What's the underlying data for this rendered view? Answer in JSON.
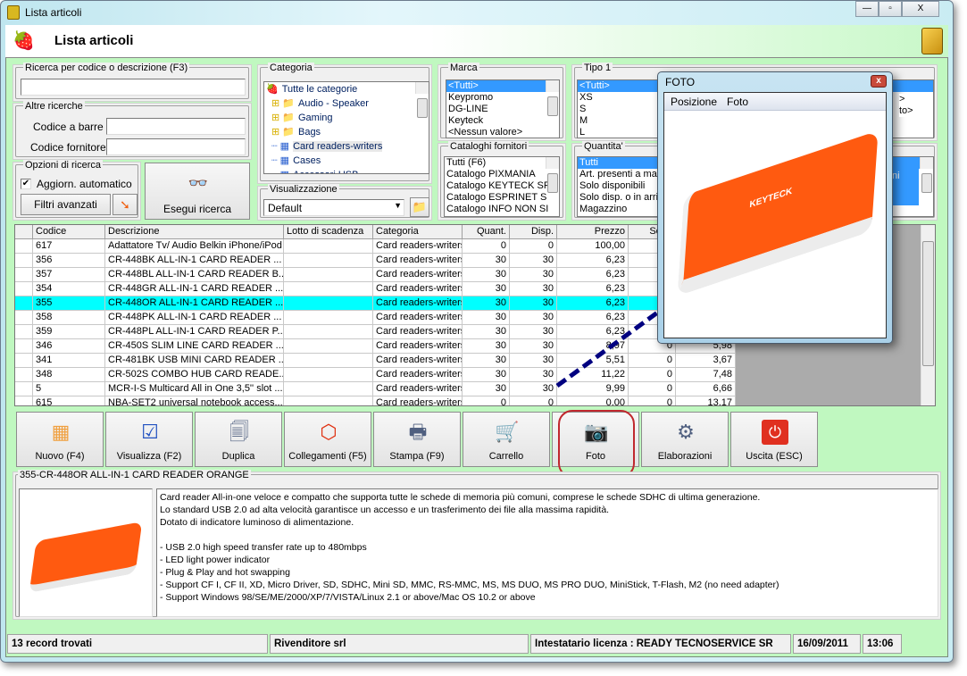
{
  "window": {
    "title": "Lista articoli",
    "minimize": "—",
    "maximize": "▫",
    "close": "X"
  },
  "header": {
    "title": "Lista articoli"
  },
  "search": {
    "legend": "Ricerca per codice o descrizione (F3)",
    "value": ""
  },
  "other": {
    "legend": "Altre ricerche",
    "barcode_label": "Codice a barre :",
    "barcode_value": "",
    "supplier_label": "Codice fornitore :",
    "supplier_value": ""
  },
  "options": {
    "legend": "Opzioni di ricerca",
    "auto_update_label": "Aggiorn. automatico",
    "auto_update_checked": true,
    "advanced_filters": "Filtri avanzati",
    "run_search": "Esegui ricerca"
  },
  "category": {
    "legend": "Categoria",
    "items": [
      "Tutte le categorie",
      "Audio - Speaker",
      "Gaming",
      "Bags",
      "Card readers-writers",
      "Cases",
      "Accessori USB"
    ],
    "selected": "Card readers-writers"
  },
  "view": {
    "legend": "Visualizzazione",
    "value": "Default"
  },
  "brand": {
    "legend": "Marca",
    "items": [
      "<Tutti>",
      "Keypromo",
      "DG-LINE",
      "Keyteck",
      "<Nessun valore>"
    ]
  },
  "catalogs": {
    "legend": "Cataloghi fornitori",
    "items": [
      "Tutti (F6)",
      "Catalogo PIXMANIA",
      "Catalogo KEYTECK SF",
      "Catalogo ESPRINET S",
      "Catalogo INFO NON SI"
    ]
  },
  "tipo1": {
    "legend": "Tipo 1",
    "items": [
      "<Tutti>",
      "XS",
      "S",
      "M",
      "L"
    ]
  },
  "tipo3": {
    "items_partial": [
      ">",
      "to>"
    ]
  },
  "quantity": {
    "legend": "Quantita'",
    "items": [
      "Tutti",
      "Art. presenti a mag",
      "Solo disponibili",
      "Solo disp. o in arriv",
      "Magazzino"
    ]
  },
  "other_group": {
    "items_partial": [
      "zioni"
    ]
  },
  "table": {
    "columns": [
      "",
      "Codice",
      "Descrizione",
      "Lotto di scadenza",
      "Categoria",
      "Quant.",
      "Disp.",
      "Prezzo",
      "Scort",
      ""
    ],
    "rows": [
      [
        "617",
        "Adattatore Tv/ Audio Belkin iPhone/iPod",
        "",
        "Card readers-writers",
        "0",
        "0",
        "100,00",
        "",
        ""
      ],
      [
        "356",
        "CR-448BK ALL-IN-1 CARD READER ...",
        "",
        "Card readers-writers",
        "30",
        "30",
        "6,23",
        "",
        ""
      ],
      [
        "357",
        "CR-448BL ALL-IN-1 CARD READER B...",
        "",
        "Card readers-writers",
        "30",
        "30",
        "6,23",
        "",
        ""
      ],
      [
        "354",
        "CR-448GR ALL-IN-1 CARD READER ...",
        "",
        "Card readers-writers",
        "30",
        "30",
        "6,23",
        "",
        ""
      ],
      [
        "355",
        "CR-448OR ALL-IN-1 CARD READER ...",
        "",
        "Card readers-writers",
        "30",
        "30",
        "6,23",
        "",
        ""
      ],
      [
        "358",
        "CR-448PK ALL-IN-1 CARD READER ...",
        "",
        "Card readers-writers",
        "30",
        "30",
        "6,23",
        "",
        ""
      ],
      [
        "359",
        "CR-448PL ALL-IN-1 CARD READER P...",
        "",
        "Card readers-writers",
        "30",
        "30",
        "6,23",
        "",
        ""
      ],
      [
        "346",
        "CR-450S SLIM LINE CARD READER ...",
        "",
        "Card readers-writers",
        "30",
        "30",
        "8,97",
        "0",
        "5,98"
      ],
      [
        "341",
        "CR-481BK USB MINI CARD READER ...",
        "",
        "Card readers-writers",
        "30",
        "30",
        "5,51",
        "0",
        "3,67"
      ],
      [
        "348",
        "CR-502S COMBO HUB CARD READE...",
        "",
        "Card readers-writers",
        "30",
        "30",
        "11,22",
        "0",
        "7,48"
      ],
      [
        "5",
        "MCR-I-S Multicard All in One 3,5'' slot ...",
        "",
        "Card readers-writers",
        "30",
        "30",
        "9,99",
        "0",
        "6,66"
      ],
      [
        "615",
        "NBA-SET2 universal notebook access...",
        "",
        "Card readers-writers",
        "0",
        "0",
        "0,00",
        "0",
        "13,17"
      ]
    ],
    "selected_code": "355",
    "highlight_color": "#00ffff"
  },
  "toolbar": [
    {
      "label": "Nuovo (F4)",
      "icon": "grid-add-icon"
    },
    {
      "label": "Visualizza (F2)",
      "icon": "grid-check-icon"
    },
    {
      "label": "Duplica",
      "icon": "duplicate-icon"
    },
    {
      "label": "Collegamenti (F5)",
      "icon": "links-icon"
    },
    {
      "label": "Stampa (F9)",
      "icon": "printer-icon"
    },
    {
      "label": "Carrello",
      "icon": "cart-icon"
    },
    {
      "label": "Foto",
      "icon": "camera-icon"
    },
    {
      "label": "Elaborazioni",
      "icon": "gear-document-icon"
    },
    {
      "label": "Uscita (ESC)",
      "icon": "power-icon"
    }
  ],
  "detail": {
    "legend": "355-CR-448OR ALL-IN-1 CARD READER ORANGE",
    "lines": [
      "Card reader All-in-one veloce e compatto che supporta tutte le schede di memoria più comuni, comprese le schede SDHC di ultima generazione.",
      "Lo standard USB 2.0 ad alta velocità garantisce un accesso e un trasferimento dei file alla massima rapidità.",
      "Dotato di indicatore luminoso di alimentazione.",
      "",
      "- USB 2.0 high speed transfer rate up to 480mbps",
      "- LED light power indicator",
      "- Plug & Play and hot swapping",
      "- Support CF I, CF II, XD, Micro Driver, SD, SDHC, Mini SD, MMC, RS-MMC, MS, MS DUO, MS PRO DUO, MiniStick, T-Flash, M2 (no need adapter)",
      "- Support Windows 98/SE/ME/2000/XP/7/VISTA/Linux 2.1 or above/Mac OS 10.2 or above"
    ]
  },
  "photo_popup": {
    "title": "FOTO",
    "menu": [
      "Posizione",
      "Foto"
    ],
    "brand_on_image": "KEYTECK",
    "close": "x"
  },
  "status": {
    "records": "13 record trovati",
    "company": "Rivenditore srl",
    "license": "Intestatario licenza : READY TECNOSERVICE SR",
    "date": "16/09/2011",
    "time": "13:06"
  },
  "colors": {
    "background": "#c0f8c0",
    "selection": "#3399ff",
    "annotation_arrow": "#000080",
    "highlight_circle": "#c0282e",
    "product_orange": "#ff5a10"
  }
}
